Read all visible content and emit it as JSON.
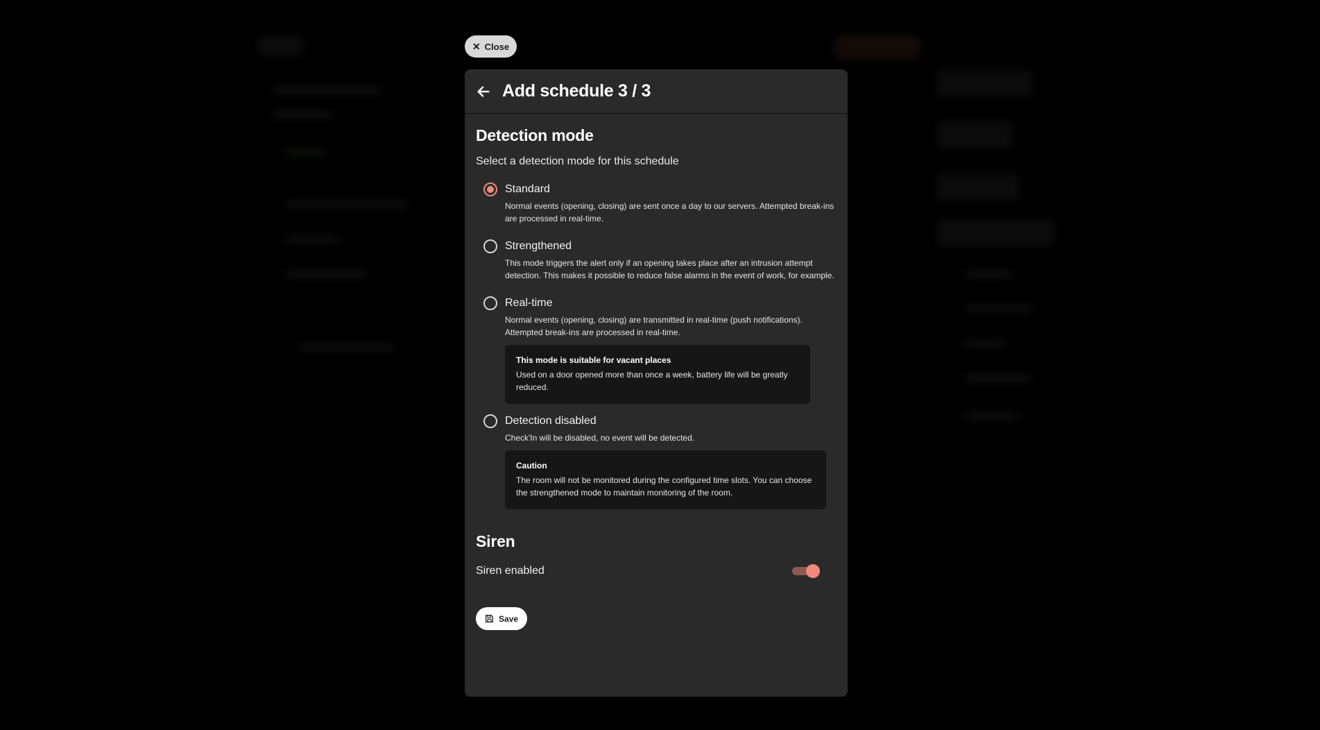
{
  "close_label": "Close",
  "modal": {
    "title": "Add schedule 3 / 3",
    "detection": {
      "heading": "Detection mode",
      "subtitle": "Select a detection mode for this schedule",
      "options": [
        {
          "label": "Standard",
          "checked": true,
          "description": "Normal events (opening, closing) are sent once a day to our servers. Attempted break-ins are processed in real-time."
        },
        {
          "label": "Strengthened",
          "checked": false,
          "description": "This mode triggers the alert only if an opening takes place after an intrusion attempt detection. This makes it possible to reduce false alarms in the event of work, for example."
        },
        {
          "label": "Real-time",
          "checked": false,
          "description": "Normal events (opening, closing) are transmitted in real-time (push notifications). Attempted break-ins are processed in real-time.",
          "notice": {
            "title": "This mode is suitable for vacant places",
            "text": "Used on a door opened more than once a week, battery life will be greatly reduced."
          }
        },
        {
          "label": "Detection disabled",
          "checked": false,
          "description": "Check'In will be disabled, no event will be detected.",
          "notice": {
            "title": "Caution",
            "text": "The room will not be monitored during the configured time slots. You can choose the strengthened mode to maintain monitoring of the room."
          }
        }
      ]
    },
    "siren": {
      "heading": "Siren",
      "label": "Siren enabled",
      "enabled": true
    },
    "save_label": "Save"
  },
  "colors": {
    "accent": "#f08a7c",
    "modal_bg": "#2a2a2a",
    "notice_bg": "#161616"
  }
}
